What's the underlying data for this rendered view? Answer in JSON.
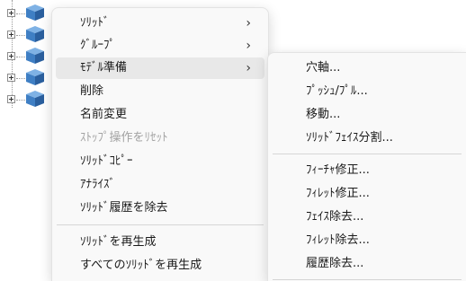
{
  "tree": {
    "nodes": [
      {
        "icon": "solid-cube-icon"
      },
      {
        "icon": "solid-cube-icon"
      },
      {
        "icon": "solid-cube-icon"
      },
      {
        "icon": "solid-cube-icon"
      },
      {
        "icon": "solid-cube-icon"
      }
    ]
  },
  "context_menu": {
    "items": [
      {
        "label": "ｿﾘｯﾄﾞ",
        "has_submenu": true
      },
      {
        "label": "ｸﾞﾙｰﾌﾟ",
        "has_submenu": true
      },
      {
        "label": "ﾓﾃﾞﾙ準備",
        "has_submenu": true,
        "highlighted": true
      },
      {
        "label": "削除"
      },
      {
        "label": "名前変更"
      },
      {
        "label": "ｽﾄｯﾌﾟ操作をﾘｾｯﾄ",
        "disabled": true
      },
      {
        "label": "ｿﾘｯﾄﾞｺﾋﾟｰ"
      },
      {
        "label": "ｱﾅﾗｲｽﾞ"
      },
      {
        "label": "ｿﾘｯﾄﾞ履歴を除去"
      },
      {
        "label": "ｿﾘｯﾄﾞを再生成"
      },
      {
        "label": "すべてのｿﾘｯﾄﾞを再生成"
      }
    ],
    "arrow_glyph": "›"
  },
  "submenu": {
    "items": [
      {
        "label": "穴軸..."
      },
      {
        "label": "ﾌﾟｯｼｭ/ﾌﾟﾙ..."
      },
      {
        "label": "移動..."
      },
      {
        "label": "ｿﾘｯﾄﾞﾌｪｲｽ分割..."
      },
      {
        "label": "ﾌｨｰﾁｬ修正..."
      },
      {
        "label": "ﾌｨﾚｯﾄ修正..."
      },
      {
        "label": "ﾌｪｲｽ除去..."
      },
      {
        "label": "ﾌｨﾚｯﾄ除去..."
      },
      {
        "label": "履歴除去..."
      }
    ]
  },
  "colors": {
    "menu_bg": "#f9f9f9",
    "hover_bg": "#e8e8e8",
    "disabled_text": "#a2a2a2",
    "cube_top": "#7fb2e5",
    "cube_left": "#3f7fc4",
    "cube_right": "#2a5f9e"
  }
}
